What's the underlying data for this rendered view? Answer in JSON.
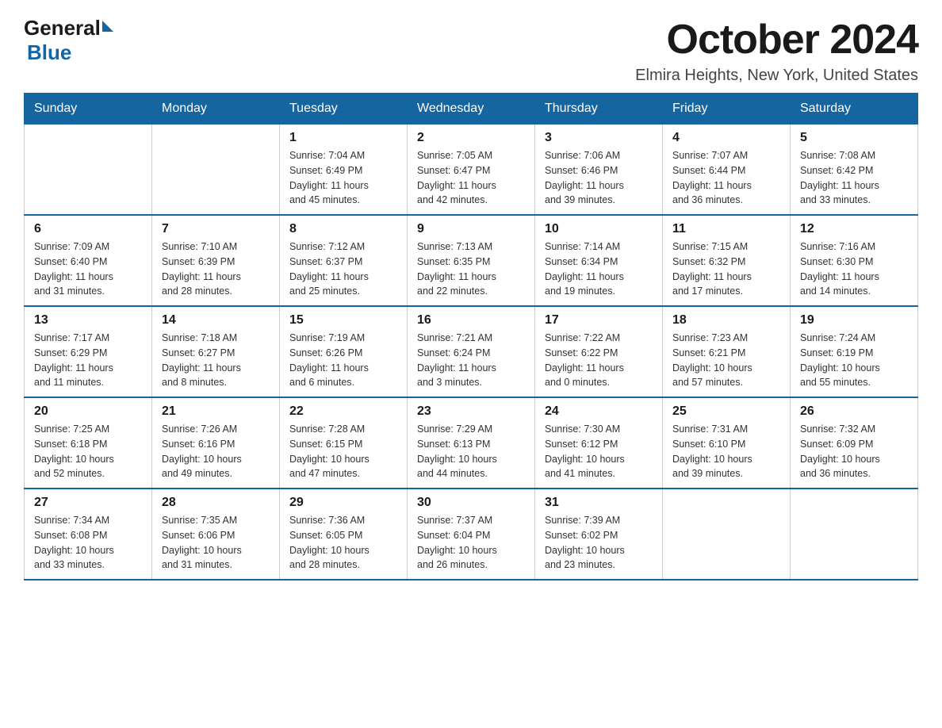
{
  "header": {
    "logo_general": "General",
    "logo_blue": "Blue",
    "month_title": "October 2024",
    "location": "Elmira Heights, New York, United States"
  },
  "days_of_week": [
    "Sunday",
    "Monday",
    "Tuesday",
    "Wednesday",
    "Thursday",
    "Friday",
    "Saturday"
  ],
  "weeks": [
    [
      {
        "day": "",
        "detail": ""
      },
      {
        "day": "",
        "detail": ""
      },
      {
        "day": "1",
        "detail": "Sunrise: 7:04 AM\nSunset: 6:49 PM\nDaylight: 11 hours\nand 45 minutes."
      },
      {
        "day": "2",
        "detail": "Sunrise: 7:05 AM\nSunset: 6:47 PM\nDaylight: 11 hours\nand 42 minutes."
      },
      {
        "day": "3",
        "detail": "Sunrise: 7:06 AM\nSunset: 6:46 PM\nDaylight: 11 hours\nand 39 minutes."
      },
      {
        "day": "4",
        "detail": "Sunrise: 7:07 AM\nSunset: 6:44 PM\nDaylight: 11 hours\nand 36 minutes."
      },
      {
        "day": "5",
        "detail": "Sunrise: 7:08 AM\nSunset: 6:42 PM\nDaylight: 11 hours\nand 33 minutes."
      }
    ],
    [
      {
        "day": "6",
        "detail": "Sunrise: 7:09 AM\nSunset: 6:40 PM\nDaylight: 11 hours\nand 31 minutes."
      },
      {
        "day": "7",
        "detail": "Sunrise: 7:10 AM\nSunset: 6:39 PM\nDaylight: 11 hours\nand 28 minutes."
      },
      {
        "day": "8",
        "detail": "Sunrise: 7:12 AM\nSunset: 6:37 PM\nDaylight: 11 hours\nand 25 minutes."
      },
      {
        "day": "9",
        "detail": "Sunrise: 7:13 AM\nSunset: 6:35 PM\nDaylight: 11 hours\nand 22 minutes."
      },
      {
        "day": "10",
        "detail": "Sunrise: 7:14 AM\nSunset: 6:34 PM\nDaylight: 11 hours\nand 19 minutes."
      },
      {
        "day": "11",
        "detail": "Sunrise: 7:15 AM\nSunset: 6:32 PM\nDaylight: 11 hours\nand 17 minutes."
      },
      {
        "day": "12",
        "detail": "Sunrise: 7:16 AM\nSunset: 6:30 PM\nDaylight: 11 hours\nand 14 minutes."
      }
    ],
    [
      {
        "day": "13",
        "detail": "Sunrise: 7:17 AM\nSunset: 6:29 PM\nDaylight: 11 hours\nand 11 minutes."
      },
      {
        "day": "14",
        "detail": "Sunrise: 7:18 AM\nSunset: 6:27 PM\nDaylight: 11 hours\nand 8 minutes."
      },
      {
        "day": "15",
        "detail": "Sunrise: 7:19 AM\nSunset: 6:26 PM\nDaylight: 11 hours\nand 6 minutes."
      },
      {
        "day": "16",
        "detail": "Sunrise: 7:21 AM\nSunset: 6:24 PM\nDaylight: 11 hours\nand 3 minutes."
      },
      {
        "day": "17",
        "detail": "Sunrise: 7:22 AM\nSunset: 6:22 PM\nDaylight: 11 hours\nand 0 minutes."
      },
      {
        "day": "18",
        "detail": "Sunrise: 7:23 AM\nSunset: 6:21 PM\nDaylight: 10 hours\nand 57 minutes."
      },
      {
        "day": "19",
        "detail": "Sunrise: 7:24 AM\nSunset: 6:19 PM\nDaylight: 10 hours\nand 55 minutes."
      }
    ],
    [
      {
        "day": "20",
        "detail": "Sunrise: 7:25 AM\nSunset: 6:18 PM\nDaylight: 10 hours\nand 52 minutes."
      },
      {
        "day": "21",
        "detail": "Sunrise: 7:26 AM\nSunset: 6:16 PM\nDaylight: 10 hours\nand 49 minutes."
      },
      {
        "day": "22",
        "detail": "Sunrise: 7:28 AM\nSunset: 6:15 PM\nDaylight: 10 hours\nand 47 minutes."
      },
      {
        "day": "23",
        "detail": "Sunrise: 7:29 AM\nSunset: 6:13 PM\nDaylight: 10 hours\nand 44 minutes."
      },
      {
        "day": "24",
        "detail": "Sunrise: 7:30 AM\nSunset: 6:12 PM\nDaylight: 10 hours\nand 41 minutes."
      },
      {
        "day": "25",
        "detail": "Sunrise: 7:31 AM\nSunset: 6:10 PM\nDaylight: 10 hours\nand 39 minutes."
      },
      {
        "day": "26",
        "detail": "Sunrise: 7:32 AM\nSunset: 6:09 PM\nDaylight: 10 hours\nand 36 minutes."
      }
    ],
    [
      {
        "day": "27",
        "detail": "Sunrise: 7:34 AM\nSunset: 6:08 PM\nDaylight: 10 hours\nand 33 minutes."
      },
      {
        "day": "28",
        "detail": "Sunrise: 7:35 AM\nSunset: 6:06 PM\nDaylight: 10 hours\nand 31 minutes."
      },
      {
        "day": "29",
        "detail": "Sunrise: 7:36 AM\nSunset: 6:05 PM\nDaylight: 10 hours\nand 28 minutes."
      },
      {
        "day": "30",
        "detail": "Sunrise: 7:37 AM\nSunset: 6:04 PM\nDaylight: 10 hours\nand 26 minutes."
      },
      {
        "day": "31",
        "detail": "Sunrise: 7:39 AM\nSunset: 6:02 PM\nDaylight: 10 hours\nand 23 minutes."
      },
      {
        "day": "",
        "detail": ""
      },
      {
        "day": "",
        "detail": ""
      }
    ]
  ]
}
